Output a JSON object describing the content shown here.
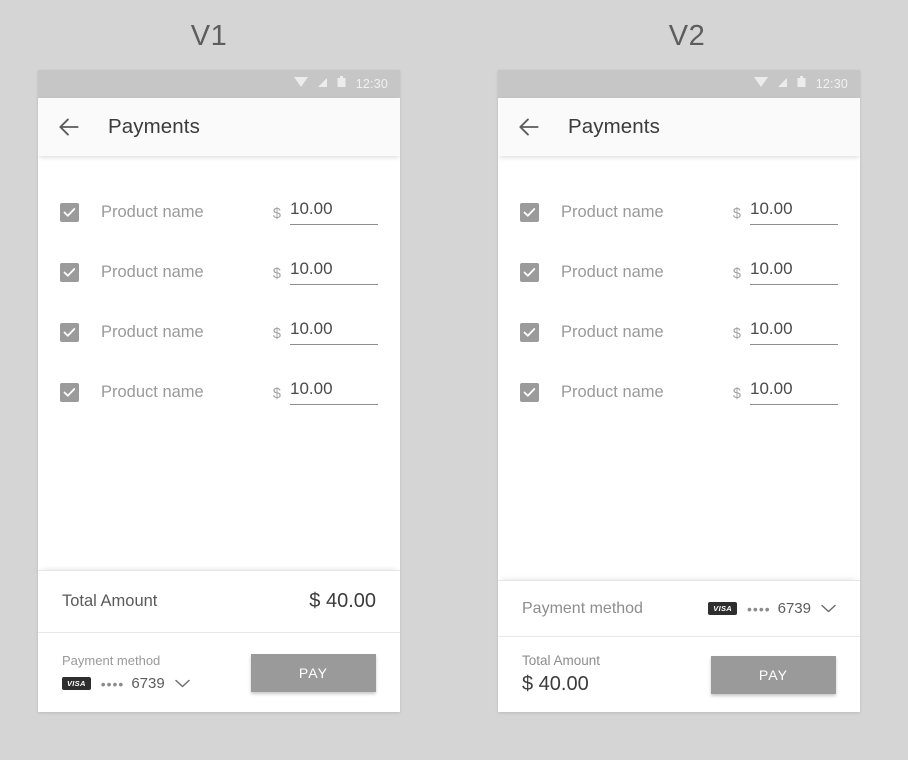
{
  "versions": [
    {
      "caption": "V1"
    },
    {
      "caption": "V2"
    }
  ],
  "status_bar": {
    "time": "12:30",
    "icons": [
      "wifi-icon",
      "signal-icon",
      "battery-icon"
    ]
  },
  "app_bar": {
    "back_icon": "back-arrow-icon",
    "title": "Payments"
  },
  "products": [
    {
      "name": "Product name",
      "currency": "$",
      "price": "10.00",
      "checked": true
    },
    {
      "name": "Product name",
      "currency": "$",
      "price": "10.00",
      "checked": true
    },
    {
      "name": "Product name",
      "currency": "$",
      "price": "10.00",
      "checked": true
    },
    {
      "name": "Product name",
      "currency": "$",
      "price": "10.00",
      "checked": true
    }
  ],
  "total": {
    "label": "Total Amount",
    "value": "$ 40.00"
  },
  "payment_method": {
    "label": "Payment method",
    "card_brand": "VISA",
    "mask": "••••",
    "last4": "6739",
    "chevron_icon": "chevron-down-icon"
  },
  "pay_button": {
    "label": "PAY"
  },
  "colors": {
    "page_background": "#d5d5d5",
    "card_background": "#ffffff",
    "status_bar": "#c6c6c6",
    "app_bar": "#fafafa",
    "checkbox_fill": "#9b9b9b",
    "pay_button": "#9a9a9a",
    "visa_chip": "#2e2e2e",
    "muted_text": "#9a9a9a",
    "primary_text": "#3c3c3c"
  }
}
